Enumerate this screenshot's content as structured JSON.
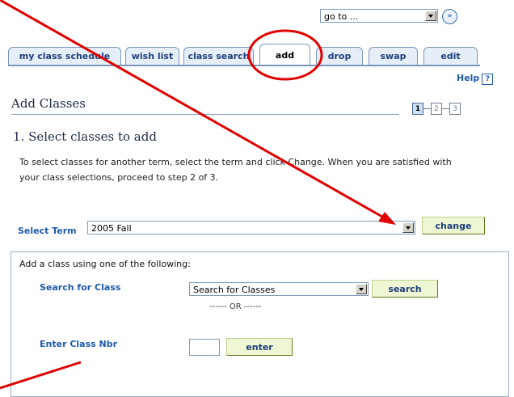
{
  "goto": {
    "value": "go to ...",
    "go_icon": "double-chevron-right-icon",
    "go_glyph": "»"
  },
  "tabs": [
    {
      "label": "my class schedule"
    },
    {
      "label": "wish list"
    },
    {
      "label": "class search"
    },
    {
      "label": "add",
      "active": true
    },
    {
      "label": "drop"
    },
    {
      "label": "swap"
    },
    {
      "label": "edit"
    }
  ],
  "help": {
    "label": "Help",
    "icon_text": "?"
  },
  "page": {
    "title": "Add Classes"
  },
  "steps": [
    "1",
    "2",
    "3"
  ],
  "section": {
    "title": "1. Select classes to add",
    "instructions": "To select classes for another term, select the term and click Change. When you are satisfied with your class selections, proceed to step 2 of 3."
  },
  "term": {
    "label": "Select Term",
    "value": "2005 Fall",
    "change_label": "change"
  },
  "add_panel": {
    "heading": "Add a class using one of the following:",
    "search_label": "Search for Class",
    "search_select_value": "Search for Classes",
    "search_button": "search",
    "or_text": "------ OR ------",
    "nbr_label": "Enter Class Nbr",
    "nbr_value": "",
    "enter_button": "enter"
  },
  "colors": {
    "annotation_red": "#e00000",
    "tab_border": "#7b97b8",
    "button_green": "#eef6d4"
  }
}
